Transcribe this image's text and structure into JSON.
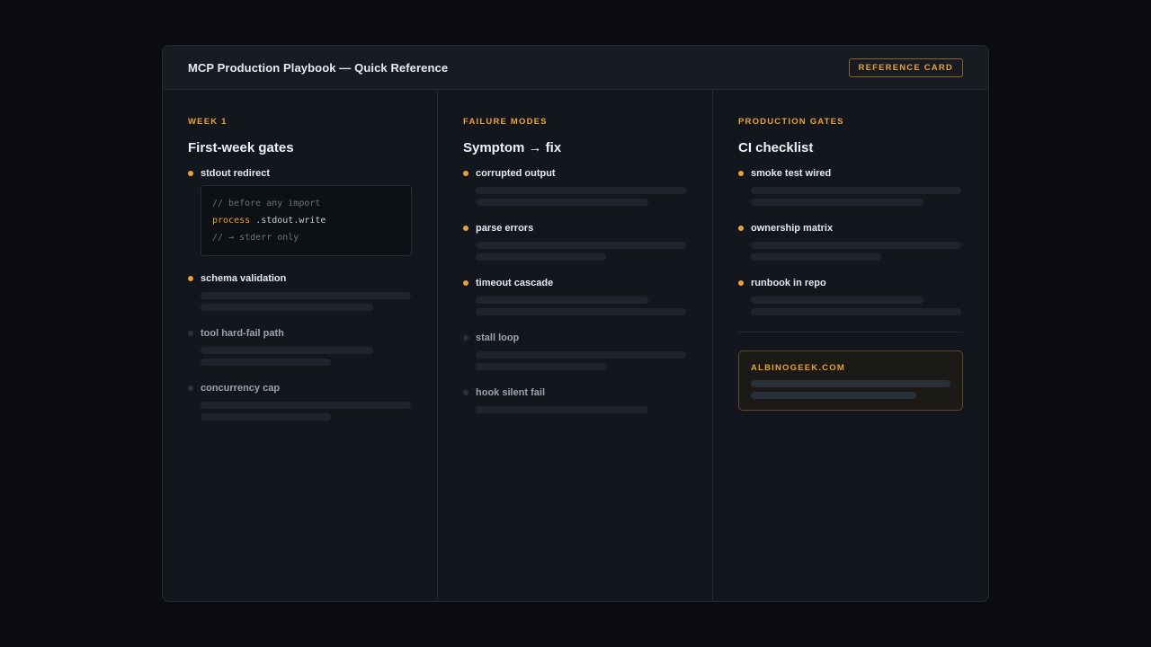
{
  "header": {
    "title": "MCP Production Playbook — Quick Reference",
    "badge": "REFERENCE CARD"
  },
  "columns": [
    {
      "eyebrow": "WEEK 1",
      "title": "First-week gates",
      "items": [
        {
          "label": "stdout redirect",
          "active": true,
          "code": {
            "line1": "// before any import",
            "keyword": "process",
            "line2_rest": ".stdout.write",
            "line3": "// → stderr only"
          }
        },
        {
          "label": "schema validation",
          "active": true
        },
        {
          "label": "tool hard-fail path",
          "active": false
        },
        {
          "label": "concurrency cap",
          "active": false
        }
      ]
    },
    {
      "eyebrow": "FAILURE MODES",
      "title": "Symptom → fix",
      "items": [
        {
          "label": "corrupted output",
          "active": true
        },
        {
          "label": "parse errors",
          "active": true
        },
        {
          "label": "timeout cascade",
          "active": true
        },
        {
          "label": "stall loop",
          "active": false
        },
        {
          "label": "hook silent fail",
          "active": false
        }
      ]
    },
    {
      "eyebrow": "PRODUCTION GATES",
      "title": "CI checklist",
      "items": [
        {
          "label": "smoke test wired",
          "active": true
        },
        {
          "label": "ownership matrix",
          "active": true
        },
        {
          "label": "runbook in repo",
          "active": true
        }
      ],
      "promo": {
        "label": "ALBINOGEEK.COM"
      }
    }
  ],
  "colors": {
    "accent": "#e8a23a",
    "card_bg": "#13171d",
    "page_bg": "#0a0c10"
  }
}
